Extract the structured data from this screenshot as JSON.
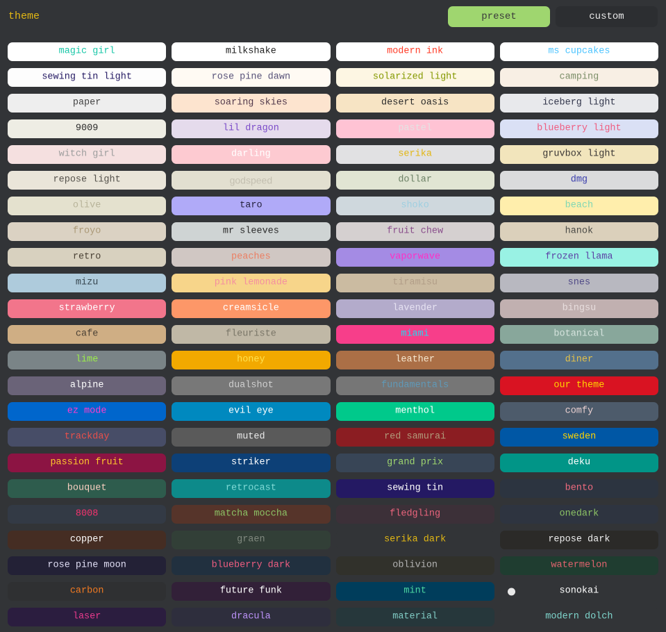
{
  "header": {
    "title": "theme",
    "toggle": {
      "preset_label": "preset",
      "custom_label": "custom",
      "active": "preset",
      "active_bg": "#9fd66f",
      "active_text": "#3b3b3b",
      "inactive_bg": "#2c2e31",
      "inactive_text": "#e8e8e8"
    }
  },
  "page": {
    "background": "#323437",
    "columns": 4
  },
  "themes": [
    {
      "name": "magic girl",
      "bg": "#ffffff",
      "fg": "#1ac7a8"
    },
    {
      "name": "milkshake",
      "bg": "#ffffff",
      "fg": "#212121"
    },
    {
      "name": "modern ink",
      "bg": "#ffffff",
      "fg": "#ff3b26"
    },
    {
      "name": "ms cupcakes",
      "bg": "#ffffff",
      "fg": "#4dc4ff"
    },
    {
      "name": "sewing tin light",
      "bg": "#fdfdfd",
      "fg": "#241963"
    },
    {
      "name": "rose pine dawn",
      "bg": "#fffaf3",
      "fg": "#575279"
    },
    {
      "name": "solarized light",
      "bg": "#fdf6e3",
      "fg": "#859900"
    },
    {
      "name": "camping",
      "bg": "#f8efe4",
      "fg": "#7d8f69"
    },
    {
      "name": "paper",
      "bg": "#eeeeee",
      "fg": "#444444"
    },
    {
      "name": "soaring skies",
      "bg": "#fde4cf",
      "fg": "#533b4d"
    },
    {
      "name": "desert oasis",
      "bg": "#f7e4c4",
      "fg": "#2b2b2b"
    },
    {
      "name": "iceberg light",
      "bg": "#e8e9ec",
      "fg": "#33374c"
    },
    {
      "name": "9009",
      "bg": "#eeede4",
      "fg": "#2b2b2b"
    },
    {
      "name": "lil dragon",
      "bg": "#e5dbec",
      "fg": "#7b4bc9"
    },
    {
      "name": "pastel",
      "bg": "#ffc3d4",
      "fg": "#e3e3e3"
    },
    {
      "name": "blueberry light",
      "bg": "#dae0f5",
      "fg": "#ef5d80"
    },
    {
      "name": "witch girl",
      "bg": "#f5e0e0",
      "fg": "#9e9e9e"
    },
    {
      "name": "darling",
      "bg": "#fdcad1",
      "fg": "#ffffff"
    },
    {
      "name": "serika",
      "bg": "#e1e1e3",
      "fg": "#e2b714"
    },
    {
      "name": "gruvbox light",
      "bg": "#f2e5bc",
      "fg": "#3c3836"
    },
    {
      "name": "repose light",
      "bg": "#eae5d9",
      "fg": "#55524c"
    },
    {
      "name": "godspeed",
      "bg": "#e2dfd0",
      "fg": "#c3bfb0",
      "font": "sans"
    },
    {
      "name": "dollar",
      "bg": "#e1e5d3",
      "fg": "#6d8266"
    },
    {
      "name": "dmg",
      "bg": "#dadbdc",
      "fg": "#3b3fad"
    },
    {
      "name": "olive",
      "bg": "#e4e1ce",
      "fg": "#b8b49a"
    },
    {
      "name": "taro",
      "bg": "#b0aaf8",
      "fg": "#26233f"
    },
    {
      "name": "shoko",
      "bg": "#cfd8dd",
      "fg": "#9fcfe0"
    },
    {
      "name": "beach",
      "bg": "#ffeeac",
      "fg": "#80d7b4"
    },
    {
      "name": "froyo",
      "bg": "#dbd2c3",
      "fg": "#ab9977"
    },
    {
      "name": "mr sleeves",
      "bg": "#cfd4d4",
      "fg": "#2b2b2b"
    },
    {
      "name": "fruit chew",
      "bg": "#d5d0d0",
      "fg": "#8a4f8c"
    },
    {
      "name": "hanok",
      "bg": "#dbd0bb",
      "fg": "#4a4a46"
    },
    {
      "name": "retro",
      "bg": "#d8d1bf",
      "fg": "#494034"
    },
    {
      "name": "peaches",
      "bg": "#d0c7c3",
      "fg": "#eb7f63"
    },
    {
      "name": "vaporwave",
      "bg": "#a48be4",
      "fg": "#ff2fc4"
    },
    {
      "name": "frozen llama",
      "bg": "#99f2e4",
      "fg": "#5c41a5"
    },
    {
      "name": "mizu",
      "bg": "#aecbdc",
      "fg": "#36464f"
    },
    {
      "name": "pink lemonade",
      "bg": "#f7d58a",
      "fg": "#f48fa0"
    },
    {
      "name": "tiramisu",
      "bg": "#cbbba1",
      "fg": "#b29e88"
    },
    {
      "name": "snes",
      "bg": "#b8b8c0",
      "fg": "#514b87"
    },
    {
      "name": "strawberry",
      "bg": "#f2758b",
      "fg": "#ffffff"
    },
    {
      "name": "creamsicle",
      "bg": "#fd9768",
      "fg": "#ffffff"
    },
    {
      "name": "lavender",
      "bg": "#b3abcb",
      "fg": "#e6e2f2"
    },
    {
      "name": "bingsu",
      "bg": "#c1b0b0",
      "fg": "#e8dede"
    },
    {
      "name": "cafe",
      "bg": "#cfae84",
      "fg": "#4c4236"
    },
    {
      "name": "fleuriste",
      "bg": "#c0b8a6",
      "fg": "#7a7668"
    },
    {
      "name": "miami",
      "bg": "#f73e8a",
      "fg": "#22d7f0"
    },
    {
      "name": "botanical",
      "bg": "#88a79b",
      "fg": "#d5e3dd"
    },
    {
      "name": "lime",
      "bg": "#7a8487",
      "fg": "#9ced4c"
    },
    {
      "name": "honey",
      "bg": "#f2a900",
      "fg": "#ffe14d"
    },
    {
      "name": "leather",
      "bg": "#ab6f46",
      "fg": "#f6e7cf"
    },
    {
      "name": "diner",
      "bg": "#53708c",
      "fg": "#e3c14a"
    },
    {
      "name": "alpine",
      "bg": "#6a6378",
      "fg": "#ffffff"
    },
    {
      "name": "dualshot",
      "bg": "#787878",
      "fg": "#cfcfcf"
    },
    {
      "name": "fundamentals",
      "bg": "#767676",
      "fg": "#5f99b8"
    },
    {
      "name": "our theme",
      "bg": "#d91322",
      "fg": "#ffd400"
    },
    {
      "name": "ez mode",
      "bg": "#0066cc",
      "fg": "#ff3ccc"
    },
    {
      "name": "evil eye",
      "bg": "#0089bf",
      "fg": "#ffffff"
    },
    {
      "name": "menthol",
      "bg": "#00c98b",
      "fg": "#ffffff"
    },
    {
      "name": "comfy",
      "bg": "#4d5b6b",
      "fg": "#e8cfcf"
    },
    {
      "name": "trackday",
      "bg": "#474d67",
      "fg": "#e9504b"
    },
    {
      "name": "muted",
      "bg": "#5a5a5a",
      "fg": "#eaeaea"
    },
    {
      "name": "red samurai",
      "bg": "#8b1d22",
      "fg": "#b19a7a"
    },
    {
      "name": "sweden",
      "bg": "#0057a5",
      "fg": "#ffd400"
    },
    {
      "name": "passion fruit",
      "bg": "#8c1443",
      "fg": "#ffc72d"
    },
    {
      "name": "striker",
      "bg": "#0d4077",
      "fg": "#ffffff"
    },
    {
      "name": "grand prix",
      "bg": "#384556",
      "fg": "#9fd66f"
    },
    {
      "name": "deku",
      "bg": "#019587",
      "fg": "#ffffff"
    },
    {
      "name": "bouquet",
      "bg": "#2e5c4d",
      "fg": "#f7cfc0"
    },
    {
      "name": "retrocast",
      "bg": "#0d8a8a",
      "fg": "#7fd9d5"
    },
    {
      "name": "sewing tin",
      "bg": "#241963",
      "fg": "#ffffff"
    },
    {
      "name": "bento",
      "bg": "#2c3440",
      "fg": "#ef6b7e"
    },
    {
      "name": "8008",
      "bg": "#333a45",
      "fg": "#f4336e"
    },
    {
      "name": "matcha moccha",
      "bg": "#56342a",
      "fg": "#8cc265"
    },
    {
      "name": "fledgling",
      "bg": "#3c3038",
      "fg": "#e9647c"
    },
    {
      "name": "onedark",
      "bg": "#2e3440",
      "fg": "#8cc265"
    },
    {
      "name": "copper",
      "bg": "#452d23",
      "fg": "#ffffff"
    },
    {
      "name": "graen",
      "bg": "#323f37",
      "fg": "#80897f"
    },
    {
      "name": "serika dark",
      "bg": "#323437",
      "fg": "#e2b714"
    },
    {
      "name": "repose dark",
      "bg": "#2b2a28",
      "fg": "#eeeeee"
    },
    {
      "name": "rose pine moon",
      "bg": "#232136",
      "fg": "#e0def4"
    },
    {
      "name": "blueberry dark",
      "bg": "#21303f",
      "fg": "#ef5d80"
    },
    {
      "name": "oblivion",
      "bg": "#31312b",
      "fg": "#b3b3b3"
    },
    {
      "name": "watermelon",
      "bg": "#1f3d30",
      "fg": "#e0636e"
    },
    {
      "name": "carbon",
      "bg": "#2f3032",
      "fg": "#f17a22"
    },
    {
      "name": "future funk",
      "bg": "#322038",
      "fg": "#ffffff"
    },
    {
      "name": "mint",
      "bg": "#003d5b",
      "fg": "#4cd6a1"
    },
    {
      "name": "sonokai",
      "bg": "#323437",
      "fg": "#ffffff",
      "indicator": true
    },
    {
      "name": "laser",
      "bg": "#2b1d3f",
      "fg": "#e83a8d"
    },
    {
      "name": "dracula",
      "bg": "#2e2e3d",
      "fg": "#bd93f9"
    },
    {
      "name": "material",
      "bg": "#26373b",
      "fg": "#80cbc4"
    },
    {
      "name": "modern dolch",
      "bg": "#323437",
      "fg": "#7fd6cd"
    }
  ]
}
